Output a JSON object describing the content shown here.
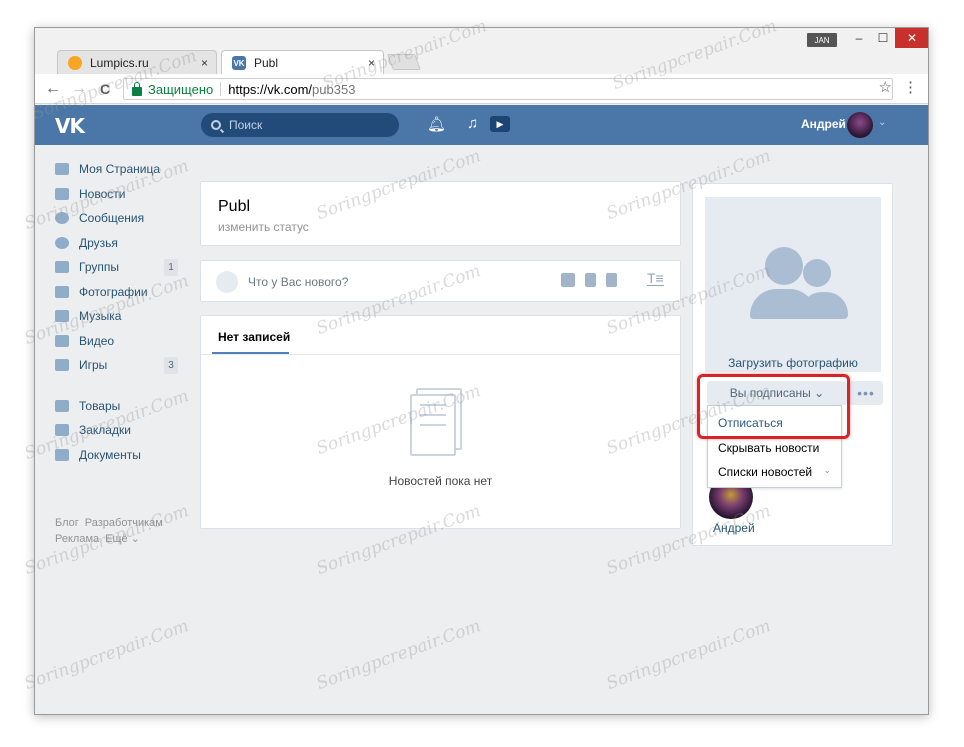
{
  "browser": {
    "tabs": [
      {
        "label": "Lumpics.ru",
        "close": "×"
      },
      {
        "label": "Publ",
        "close": "×"
      }
    ],
    "user_badge": "JAN",
    "minimize": "–",
    "maximize": "☐",
    "close": "✕",
    "back": "←",
    "forward": "→",
    "reload": "C",
    "secure_label": "Защищено",
    "url_host": "https://vk.com/",
    "url_path": "pub353",
    "star": "☆",
    "menu": "⋮"
  },
  "vk_header": {
    "logo": "VK",
    "search_placeholder": "Поиск",
    "user_name": "Андрей"
  },
  "sidebar": {
    "items": [
      {
        "label": "Моя Страница",
        "icon": "home-icon"
      },
      {
        "label": "Новости",
        "icon": "news-icon"
      },
      {
        "label": "Сообщения",
        "icon": "messages-icon"
      },
      {
        "label": "Друзья",
        "icon": "friends-icon"
      },
      {
        "label": "Группы",
        "icon": "groups-icon",
        "count": "1"
      },
      {
        "label": "Фотографии",
        "icon": "photos-icon"
      },
      {
        "label": "Музыка",
        "icon": "music-icon"
      },
      {
        "label": "Видео",
        "icon": "video-icon"
      },
      {
        "label": "Игры",
        "icon": "games-icon",
        "count": "3"
      },
      {
        "label": "Товары",
        "icon": "goods-icon"
      },
      {
        "label": "Закладки",
        "icon": "bookmarks-icon"
      },
      {
        "label": "Документы",
        "icon": "documents-icon"
      }
    ],
    "footer": [
      "Блог",
      "Разработчикам",
      "Реклама",
      "Ещё ⌄"
    ]
  },
  "page": {
    "name": "Publ",
    "status": "изменить статус",
    "post_placeholder": "Что у Вас нового?",
    "wall_tab": "Нет записей",
    "empty_text": "Новостей пока нет"
  },
  "right": {
    "upload_photo": "Загрузить фотографию",
    "subscribed": "Вы подписаны ⌄",
    "more": "•••",
    "menu": [
      "Отписаться",
      "Скрывать новости",
      "Списки новостей"
    ],
    "follower_name": "Андрей"
  },
  "watermark": "Soringpcrepair.Com",
  "colors": {
    "vk_blue": "#4a76a8",
    "link": "#285473",
    "highlight_red": "#d9232b",
    "page_bg": "#edeef0"
  }
}
